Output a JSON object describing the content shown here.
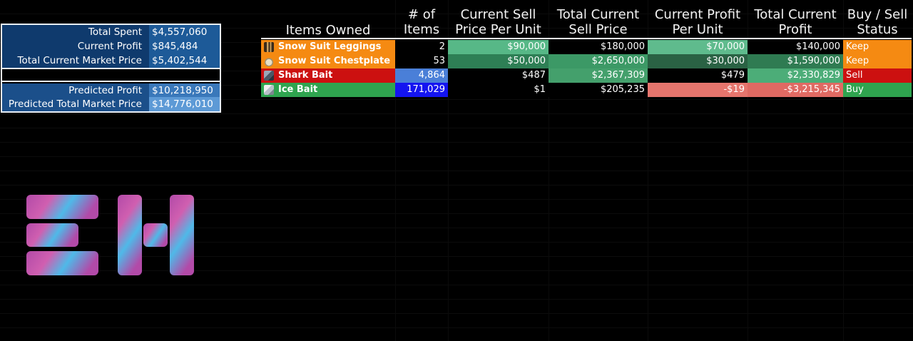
{
  "summary": {
    "total_spent_label": "Total Spent",
    "total_spent_value": "$4,557,060",
    "current_profit_label": "Current Profit",
    "current_profit_value": "$845,484",
    "total_market_label": "Total Current Market Price",
    "total_market_value": "$5,402,544",
    "predicted_profit_label": "Predicted Profit",
    "predicted_profit_value": "$10,218,950",
    "predicted_market_label": "Predicted Total Market Price",
    "predicted_market_value": "$14,776,010"
  },
  "table": {
    "headers": {
      "items_owned": "Items Owned",
      "num_items_1": "# of",
      "num_items_2": "Items",
      "sell_price_1": "Current Sell",
      "sell_price_2": "Price Per Unit",
      "total_sell_1": "Total Current",
      "total_sell_2": "Sell Price",
      "profit_unit_1": "Current Profit",
      "profit_unit_2": "Per Unit",
      "total_profit_1": "Total Current",
      "total_profit_2": "Profit",
      "status_1": "Buy / Sell",
      "status_2": "Status"
    },
    "rows": [
      {
        "icon": "leggings-icon",
        "name": "Snow Suit Leggings",
        "count": "2",
        "sell_price": "$90,000",
        "total_sell": "$180,000",
        "profit_unit": "$70,000",
        "total_profit": "$140,000",
        "status": "Keep"
      },
      {
        "icon": "chestplate-icon",
        "name": "Snow Suit Chestplate",
        "count": "53",
        "sell_price": "$50,000",
        "total_sell": "$2,650,000",
        "profit_unit": "$30,000",
        "total_profit": "$1,590,000",
        "status": "Keep"
      },
      {
        "icon": "shark-bait-icon",
        "name": "Shark Bait",
        "count": "4,864",
        "sell_price": "$487",
        "total_sell": "$2,367,309",
        "profit_unit": "$479",
        "total_profit": "$2,330,829",
        "status": "Sell"
      },
      {
        "icon": "ice-bait-icon",
        "name": "Ice Bait",
        "count": "171,029",
        "sell_price": "$1",
        "total_sell": "$205,235",
        "profit_unit": "-$19",
        "total_profit": "-$3,215,345",
        "status": "Buy"
      }
    ]
  },
  "colors": {
    "keep": "#f58a12",
    "sell": "#cc1010",
    "buy": "#2fa44f",
    "navy": "#0f3a6d"
  }
}
